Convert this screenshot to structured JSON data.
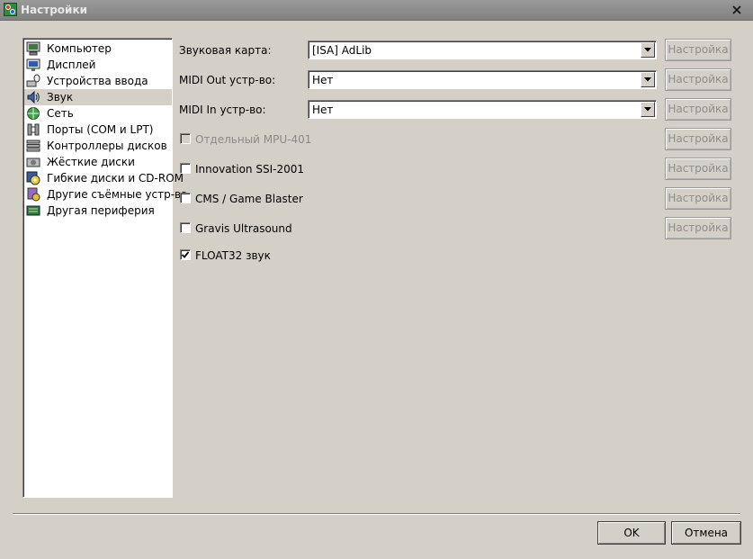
{
  "window": {
    "title": "Настройки",
    "title_icon": "settings-app-icon",
    "close_icon": "close-icon"
  },
  "sidebar": {
    "items": [
      {
        "label": "Компьютер",
        "icon": "computer-icon",
        "selected": false
      },
      {
        "label": "Дисплей",
        "icon": "display-icon",
        "selected": false
      },
      {
        "label": "Устройства ввода",
        "icon": "input-devices-icon",
        "selected": false
      },
      {
        "label": "Звук",
        "icon": "sound-icon",
        "selected": true
      },
      {
        "label": "Сеть",
        "icon": "network-icon",
        "selected": false
      },
      {
        "label": "Порты (COM и LPT)",
        "icon": "ports-icon",
        "selected": false
      },
      {
        "label": "Контроллеры дисков",
        "icon": "disk-controllers-icon",
        "selected": false
      },
      {
        "label": "Жёсткие диски",
        "icon": "hard-disks-icon",
        "selected": false
      },
      {
        "label": "Гибкие диски и CD-ROM",
        "icon": "floppy-cdrom-icon",
        "selected": false
      },
      {
        "label": "Другие съёмные устр-ва",
        "icon": "removable-devices-icon",
        "selected": false
      },
      {
        "label": "Другая периферия",
        "icon": "peripherals-icon",
        "selected": false
      }
    ]
  },
  "sound": {
    "sound_card": {
      "label": "Звуковая карта:",
      "value": "[ISA] AdLib",
      "configure": "Настройка"
    },
    "midi_out": {
      "label": "MIDI Out устр-во:",
      "value": "Нет",
      "configure": "Настройка"
    },
    "midi_in": {
      "label": "MIDI In устр-во:",
      "value": "Нет",
      "configure": "Настройка"
    },
    "checkboxes": [
      {
        "label": "Отдельный MPU-401",
        "checked": false,
        "disabled": true,
        "configure": "Настройка"
      },
      {
        "label": "Innovation SSI-2001",
        "checked": false,
        "disabled": false,
        "configure": "Настройка"
      },
      {
        "label": "CMS / Game Blaster",
        "checked": false,
        "disabled": false,
        "configure": "Настройка"
      },
      {
        "label": "Gravis Ultrasound",
        "checked": false,
        "disabled": false,
        "configure": "Настройка"
      },
      {
        "label": "FLOAT32 звук",
        "checked": true,
        "disabled": false
      }
    ]
  },
  "footer": {
    "ok": "OK",
    "cancel": "Отмена"
  },
  "colors": {
    "dialog_bg": "#d4d0c8",
    "titlebar": "#8c8c8c",
    "disabled_text": "#8a8a8a"
  }
}
